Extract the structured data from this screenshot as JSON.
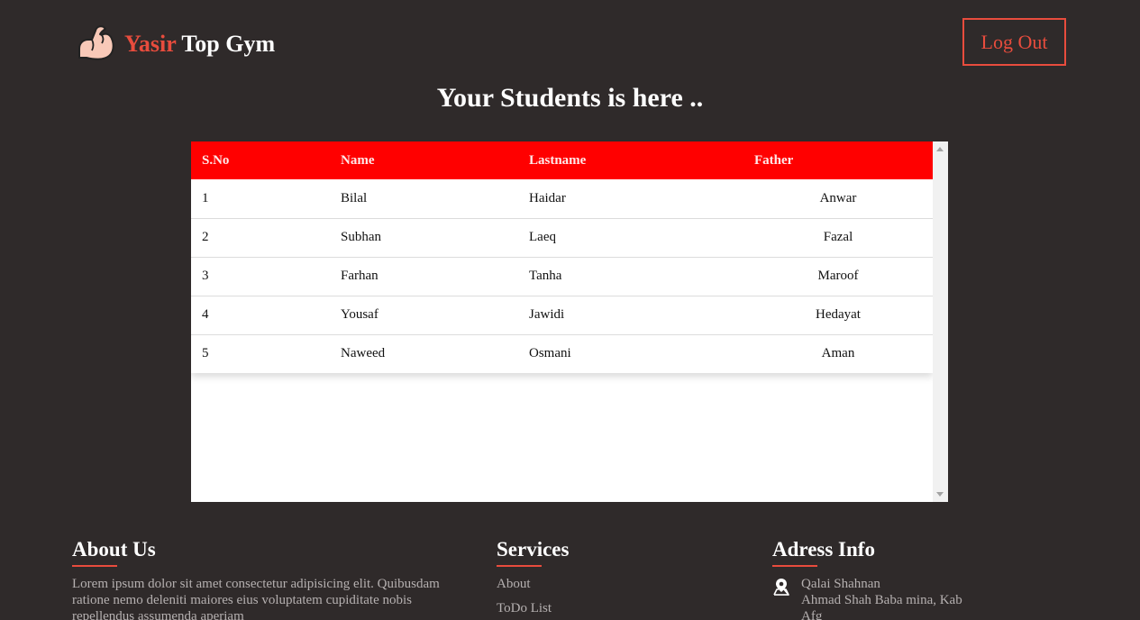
{
  "header": {
    "brand_first": "Yasir",
    "brand_second": "Top Gym",
    "logout_label": "Log Out",
    "logo_icon": "flexed-biceps-icon"
  },
  "page_title": "Your Students is here ..",
  "table": {
    "headers": [
      "S.No",
      "Name",
      "Lastname",
      "Father"
    ],
    "rows": [
      [
        "1",
        "Bilal",
        "Haidar",
        "Anwar"
      ],
      [
        "2",
        "Subhan",
        "Laeq",
        "Fazal"
      ],
      [
        "3",
        "Farhan",
        "Tanha",
        "Maroof"
      ],
      [
        "4",
        "Yousaf",
        "Jawidi",
        "Hedayat"
      ],
      [
        "5",
        "Naweed",
        "Osmani",
        "Aman"
      ]
    ]
  },
  "footer": {
    "about": {
      "title": "About Us",
      "line1": "Lorem ipsum dolor sit amet consectetur adipisicing elit. Quibusdam",
      "line2": "ratione nemo deleniti maiores eius voluptatem cupiditate nobis",
      "line3": "repellendus assumenda aperiam"
    },
    "services": {
      "title": "Services",
      "links": [
        "About",
        "ToDo List"
      ]
    },
    "address": {
      "title": "Adress Info",
      "icon": "location-pin-icon",
      "line1": "Qalai Shahnan",
      "line2": "Ahmad Shah Baba mina, Kab",
      "line3": "Afg"
    }
  },
  "colors": {
    "background": "#2f2a2a",
    "accent": "#e84c3d",
    "table_header": "#ff0000"
  }
}
